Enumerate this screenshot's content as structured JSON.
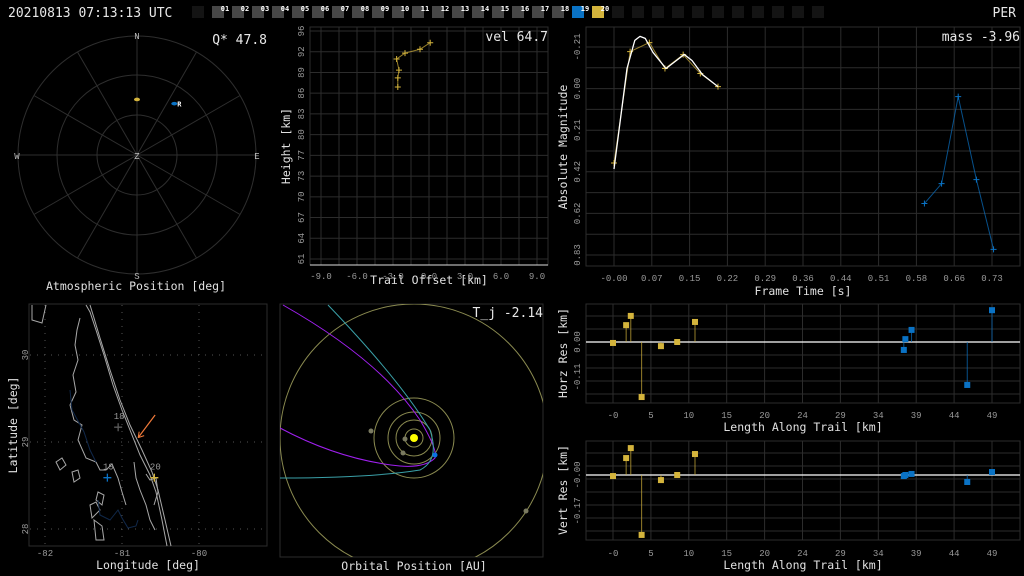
{
  "header": {
    "timestamp": "20210813 07:13:13 UTC",
    "shower_code": "PER",
    "frames": [
      {
        "label": "",
        "state": "empty"
      },
      {
        "label": "01",
        "state": "gray"
      },
      {
        "label": "02",
        "state": "gray"
      },
      {
        "label": "03",
        "state": "gray"
      },
      {
        "label": "04",
        "state": "gray"
      },
      {
        "label": "05",
        "state": "gray"
      },
      {
        "label": "06",
        "state": "gray"
      },
      {
        "label": "07",
        "state": "gray"
      },
      {
        "label": "08",
        "state": "gray"
      },
      {
        "label": "09",
        "state": "gray"
      },
      {
        "label": "10",
        "state": "gray"
      },
      {
        "label": "11",
        "state": "gray"
      },
      {
        "label": "12",
        "state": "gray"
      },
      {
        "label": "13",
        "state": "gray"
      },
      {
        "label": "14",
        "state": "gray"
      },
      {
        "label": "15",
        "state": "gray"
      },
      {
        "label": "16",
        "state": "gray"
      },
      {
        "label": "17",
        "state": "gray"
      },
      {
        "label": "18",
        "state": "gray"
      },
      {
        "label": "19",
        "state": "blue"
      },
      {
        "label": "20",
        "state": "yellow"
      },
      {
        "label": "",
        "state": "empty"
      },
      {
        "label": "",
        "state": "empty"
      },
      {
        "label": "",
        "state": "empty"
      },
      {
        "label": "",
        "state": "empty"
      },
      {
        "label": "",
        "state": "empty"
      },
      {
        "label": "",
        "state": "empty"
      },
      {
        "label": "",
        "state": "empty"
      },
      {
        "label": "",
        "state": "empty"
      },
      {
        "label": "",
        "state": "empty"
      },
      {
        "label": "",
        "state": "empty"
      },
      {
        "label": "",
        "state": "empty"
      }
    ]
  },
  "colors": {
    "station_a": "#d4b43c",
    "station_b": "#0a72c4",
    "gray_frame": "#474747",
    "empty_frame": "#141414",
    "fit": "#ffffff",
    "arrow": "#f07a3a",
    "purple": "#a020f0",
    "cyan": "#3aa0a8",
    "orbit": "#8a8a50",
    "sun": "#ffff00"
  },
  "polar": {
    "annotation": "Q* 47.8",
    "title": "Atmospheric Position [deg]",
    "cardinals": {
      "n": "N",
      "s": "S",
      "e": "E",
      "w": "W",
      "z": "Z"
    },
    "points": [
      {
        "station": "a",
        "azimuth_deg": 0,
        "altitude_deg": 48,
        "label": ""
      },
      {
        "station": "b",
        "azimuth_deg": 36,
        "altitude_deg": 42,
        "label": "R"
      }
    ]
  },
  "map": {
    "xlabel": "Longitude [deg]",
    "ylabel": "Latitude [deg]",
    "x_ticks": [
      "-82",
      "-81",
      "-80"
    ],
    "y_ticks": [
      "30",
      "29",
      "28"
    ],
    "stations": [
      {
        "label": "18",
        "lon": -81.05,
        "lat": 29.17,
        "color": "#5a5a5a"
      },
      {
        "label": "19",
        "lon": -81.19,
        "lat": 28.59,
        "color": "#0a72c4"
      },
      {
        "label": "20",
        "lon": -80.58,
        "lat": 28.59,
        "color": "#d4b43c"
      }
    ],
    "trajectory": {
      "start": [
        -80.57,
        29.31
      ],
      "end": [
        -80.79,
        29.05
      ]
    }
  },
  "orbit": {
    "annotation": "T_j -2.14",
    "title": "Orbital Position [AU]"
  },
  "chart_data": [
    {
      "id": "height",
      "type": "line",
      "annotation": "vel 64.7",
      "xlabel": "Trail Offset [km]",
      "ylabel": "Height [km]",
      "x_ticks": [
        "-9.0",
        "-6.0",
        "-3.0",
        "0.0",
        "3.0",
        "6.0",
        "9.0"
      ],
      "y_ticks": [
        "96",
        "92",
        "89",
        "86",
        "83",
        "80",
        "77",
        "73",
        "70",
        "67",
        "64",
        "61"
      ],
      "xlim": [
        -9,
        9
      ],
      "ylim": [
        61,
        96
      ],
      "series": [
        {
          "name": "20",
          "station": "a",
          "x": [
            0.1,
            -0.75,
            -2.0,
            -2.7,
            -2.5,
            -2.6,
            -2.6
          ],
          "y": [
            94.2,
            93.2,
            92.6,
            91.7,
            90.0,
            88.8,
            87.4
          ]
        }
      ]
    },
    {
      "id": "magnitude",
      "type": "line",
      "annotation": "mass -3.96",
      "xlabel": "Frame Time [s]",
      "ylabel": "Absolute Magnitude",
      "x_ticks": [
        "-0.00",
        "0.07",
        "0.15",
        "0.22",
        "0.29",
        "0.36",
        "0.44",
        "0.51",
        "0.58",
        "0.66",
        "0.73"
      ],
      "y_ticks": [
        "-0.21",
        "0.00",
        "0.21",
        "0.42",
        "0.62",
        "0.83"
      ],
      "xlim": [
        0,
        0.727
      ],
      "ylim": [
        -0.207,
        0.828
      ],
      "series": [
        {
          "name": "20",
          "station": "a",
          "x": [
            0.0,
            0.031,
            0.068,
            0.098,
            0.133,
            0.166,
            0.2
          ],
          "y": [
            0.37,
            -0.184,
            -0.229,
            -0.1,
            -0.169,
            -0.075,
            -0.01
          ]
        },
        {
          "name": "19",
          "station": "b",
          "x": [
            0.597,
            0.63,
            0.662,
            0.697,
            0.73
          ],
          "y": [
            0.572,
            0.473,
            0.04,
            0.453,
            0.8
          ]
        },
        {
          "name": "fit",
          "station": "fit",
          "x": [
            0.0,
            0.01,
            0.025,
            0.04,
            0.05,
            0.06,
            0.075,
            0.1,
            0.12,
            0.135,
            0.15,
            0.17,
            0.2
          ],
          "y": [
            0.4,
            0.2,
            -0.1,
            -0.24,
            -0.26,
            -0.25,
            -0.18,
            -0.1,
            -0.14,
            -0.17,
            -0.14,
            -0.07,
            -0.01
          ]
        }
      ]
    },
    {
      "id": "horz_res",
      "type": "scatter",
      "xlabel": "Length Along Trail [km]",
      "ylabel": "Horz Res [km]",
      "x_ticks": [
        "-0",
        "5",
        "10",
        "15",
        "20",
        "24",
        "29",
        "34",
        "39",
        "44",
        "49"
      ],
      "y_ticks": [
        "0.00",
        "-0.11"
      ],
      "xlim": [
        0,
        49
      ],
      "ylim": [
        -0.11,
        0.0
      ],
      "series": [
        {
          "name": "20",
          "station": "a",
          "x": [
            0,
            1.7,
            2.3,
            3.7,
            6.2,
            8.3,
            10.6
          ],
          "y": [
            -0.003,
            0.053,
            0.082,
            -0.173,
            -0.013,
            0.0,
            0.063
          ]
        },
        {
          "name": "19",
          "station": "b",
          "x": [
            37.6,
            37.8,
            38.6,
            45.8,
            49.0
          ],
          "y": [
            -0.025,
            0.009,
            0.038,
            -0.135,
            0.1
          ]
        }
      ]
    },
    {
      "id": "vert_res",
      "type": "scatter",
      "xlabel": "Length Along Trail [km]",
      "ylabel": "Vert Res [km]",
      "x_ticks": [
        "-0",
        "5",
        "10",
        "15",
        "20",
        "24",
        "29",
        "34",
        "39",
        "44",
        "49"
      ],
      "y_ticks": [
        "-0.00",
        "-0.17"
      ],
      "xlim": [
        0,
        49
      ],
      "ylim": [
        -0.17,
        0.0
      ],
      "series": [
        {
          "name": "20",
          "station": "a",
          "x": [
            0,
            1.7,
            2.3,
            3.7,
            6.2,
            8.3,
            10.6
          ],
          "y": [
            -0.005,
            0.08,
            0.127,
            -0.283,
            -0.024,
            0.0,
            0.099
          ]
        },
        {
          "name": "19",
          "station": "b",
          "x": [
            37.6,
            37.8,
            38.6,
            45.8,
            49.0
          ],
          "y": [
            -0.005,
            0.0,
            0.005,
            -0.033,
            0.014
          ]
        }
      ]
    }
  ]
}
